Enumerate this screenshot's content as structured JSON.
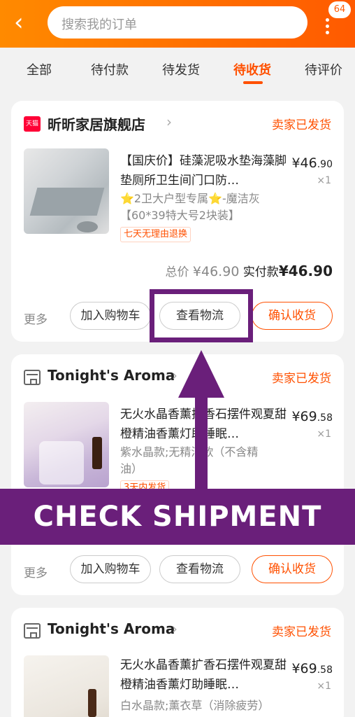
{
  "header": {
    "back_icon": "chevron-left-icon",
    "search_placeholder": "搜索我的订单",
    "more_icon": "more-vertical-icon",
    "badge_count": "64",
    "colors": {
      "gradient_start": "#ff8a00",
      "gradient_end": "#ff5a00"
    }
  },
  "tabs": [
    {
      "label": "全部",
      "active": false
    },
    {
      "label": "待付款",
      "active": false
    },
    {
      "label": "待发货",
      "active": false
    },
    {
      "label": "待收货",
      "active": true
    },
    {
      "label": "待评价",
      "active": false
    }
  ],
  "orders": [
    {
      "shop_icon": "tmall-icon",
      "shop_icon_text": "天猫",
      "shop_name": "昕昕家居旗舰店",
      "status": "卖家已发货",
      "title": "【国庆价】硅藻泥吸水垫海藻脚垫厕所卫生间门口防…",
      "price_int": "¥46",
      "price_dec": ".90",
      "qty": "×1",
      "sku_star1": "⭐",
      "sku_mid": "2卫大户型专属",
      "sku_star2": "⭐",
      "sku_rest": "-魔洁灰",
      "sku_line2": "【60*39特大号2块装】",
      "tag": "七天无理由退换",
      "total_label": "总价",
      "total_value": "¥46.90",
      "paid_label": "实付款",
      "paid_value": "¥46.90",
      "more": "更多",
      "btn_cart": "加入购物车",
      "btn_logistics": "查看物流",
      "btn_confirm": "确认收货"
    },
    {
      "shop_icon": "store-icon",
      "shop_name": "Tonight's Aroma",
      "status": "卖家已发货",
      "title": "无火水晶香薰扩香石摆件观夏甜橙精油香薰灯助睡眠…",
      "price_int": "¥69",
      "price_dec": ".58",
      "qty": "×1",
      "sku_line1": "紫水晶款;无精油款（不含精",
      "sku_line2": "油）",
      "tag": "3天内发货",
      "more": "更多",
      "btn_cart": "加入购物车",
      "btn_logistics": "查看物流",
      "btn_confirm": "确认收货"
    },
    {
      "shop_icon": "store-icon",
      "shop_name": "Tonight's Aroma",
      "status": "卖家已发货",
      "title": "无火水晶香薰扩香石摆件观夏甜橙精油香薰灯助睡眠…",
      "price_int": "¥69",
      "price_dec": ".58",
      "qty": "×1",
      "sku_line1": "白水晶款;薰衣草（消除疲劳）"
    }
  ],
  "overlay": {
    "banner_text": "CHECK SHIPMENT",
    "color": "#6a1f7a"
  }
}
